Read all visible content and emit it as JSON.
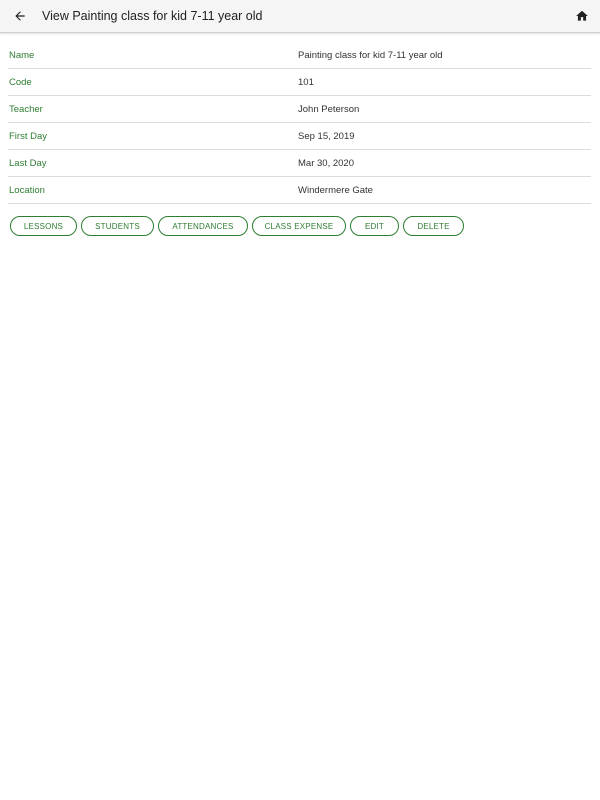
{
  "header": {
    "title": "View Painting class for kid 7-11 year old",
    "back_icon": "arrow-left-icon",
    "home_icon": "home-icon"
  },
  "details": [
    {
      "label": "Name",
      "value": "Painting class for kid 7-11 year old"
    },
    {
      "label": "Code",
      "value": "101"
    },
    {
      "label": "Teacher",
      "value": "John Peterson"
    },
    {
      "label": "First Day",
      "value": "Sep 15, 2019"
    },
    {
      "label": "Last Day",
      "value": "Mar 30, 2020"
    },
    {
      "label": "Location",
      "value": "Windermere Gate"
    }
  ],
  "actions": {
    "lessons": "LESSONS",
    "students": "STUDENTS",
    "attendances": "ATTENDANCES",
    "class_expense": "CLASS EXPENSE",
    "edit": "EDIT",
    "delete": "DELETE"
  },
  "colors": {
    "accent": "#2e7d32",
    "appbar": "#f5f5f5",
    "text": "#333333"
  }
}
